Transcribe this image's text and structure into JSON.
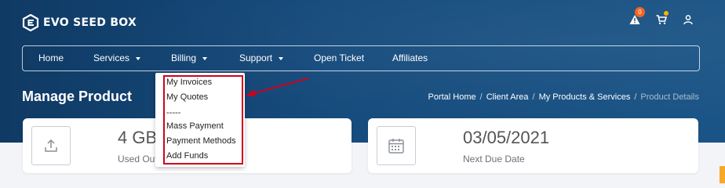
{
  "brand": {
    "name": "EVO SEED BOX"
  },
  "top_icons": {
    "alert_badge": "0",
    "alert_icon": "warning-triangle",
    "cart_icon": "shopping-cart",
    "user_icon": "user"
  },
  "nav": {
    "home": "Home",
    "services": "Services",
    "billing": "Billing",
    "support": "Support",
    "open_ticket": "Open Ticket",
    "affiliates": "Affiliates"
  },
  "billing_menu": {
    "items": [
      {
        "label": "My Invoices"
      },
      {
        "label": "My Quotes"
      },
      {
        "label": "-----"
      },
      {
        "label": "Mass Payment"
      },
      {
        "label": "Payment Methods"
      },
      {
        "label": "Add Funds"
      }
    ]
  },
  "page": {
    "title": "Manage Product",
    "breadcrumb": [
      "Portal Home",
      "Client Area",
      "My Products & Services",
      "Product Details"
    ]
  },
  "cards": [
    {
      "value": "4 GB",
      "label": "Used Out",
      "icon": "upload-icon"
    },
    {
      "value": "03/05/2021",
      "label": "Next Due Date",
      "icon": "calendar-icon"
    }
  ],
  "colors": {
    "header_bg": "#164b7d",
    "highlight": "#d0021b",
    "badge": "#f26522",
    "accent": "#f7a825"
  }
}
